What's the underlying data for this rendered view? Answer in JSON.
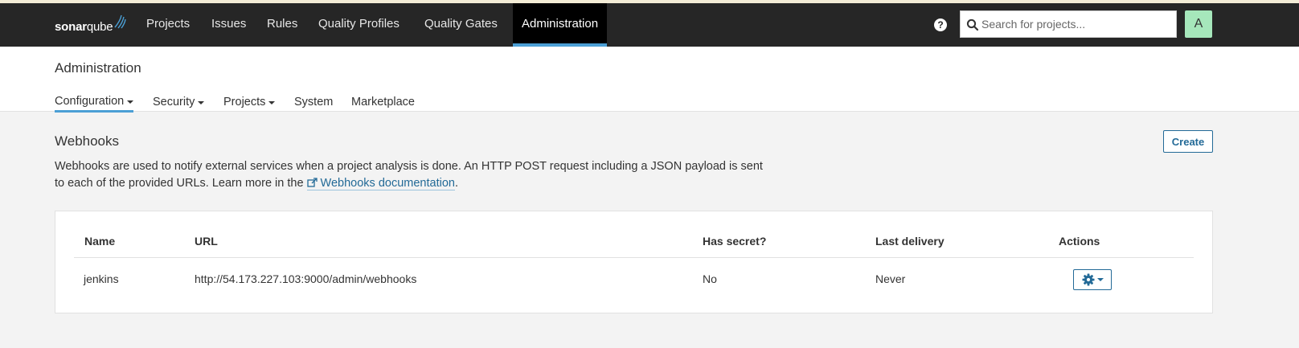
{
  "nav": {
    "logo_bold": "sonar",
    "logo_rest": "qube",
    "items": [
      {
        "label": "Projects"
      },
      {
        "label": "Issues"
      },
      {
        "label": "Rules"
      },
      {
        "label": "Quality Profiles"
      },
      {
        "label": "Quality Gates"
      },
      {
        "label": "Administration",
        "active": true
      }
    ],
    "help_label": "?",
    "search_placeholder": "Search for projects...",
    "avatar_letter": "A",
    "avatar_color": "#a6e7bb",
    "accent_color": "#4b9fd5"
  },
  "admin": {
    "title": "Administration",
    "subnav": [
      {
        "label": "Configuration",
        "dropdown": true,
        "active": true
      },
      {
        "label": "Security",
        "dropdown": true
      },
      {
        "label": "Projects",
        "dropdown": true
      },
      {
        "label": "System",
        "dropdown": false
      },
      {
        "label": "Marketplace",
        "dropdown": false
      }
    ]
  },
  "webhooks": {
    "title": "Webhooks",
    "create_label": "Create",
    "description_line1": "Webhooks are used to notify external services when a project analysis is done. An HTTP POST request including a JSON payload is sent",
    "description_line2": "to each of the provided URLs. Learn more in the ",
    "doc_link_label": "Webhooks documentation",
    "description_end": ".",
    "columns": [
      "Name",
      "URL",
      "Has secret?",
      "Last delivery",
      "Actions"
    ],
    "rows": [
      {
        "name": "jenkins",
        "url": "http://54.173.227.103:9000/admin/webhooks",
        "has_secret": "No",
        "last_delivery": "Never",
        "action_icon": "gear-icon"
      }
    ]
  }
}
